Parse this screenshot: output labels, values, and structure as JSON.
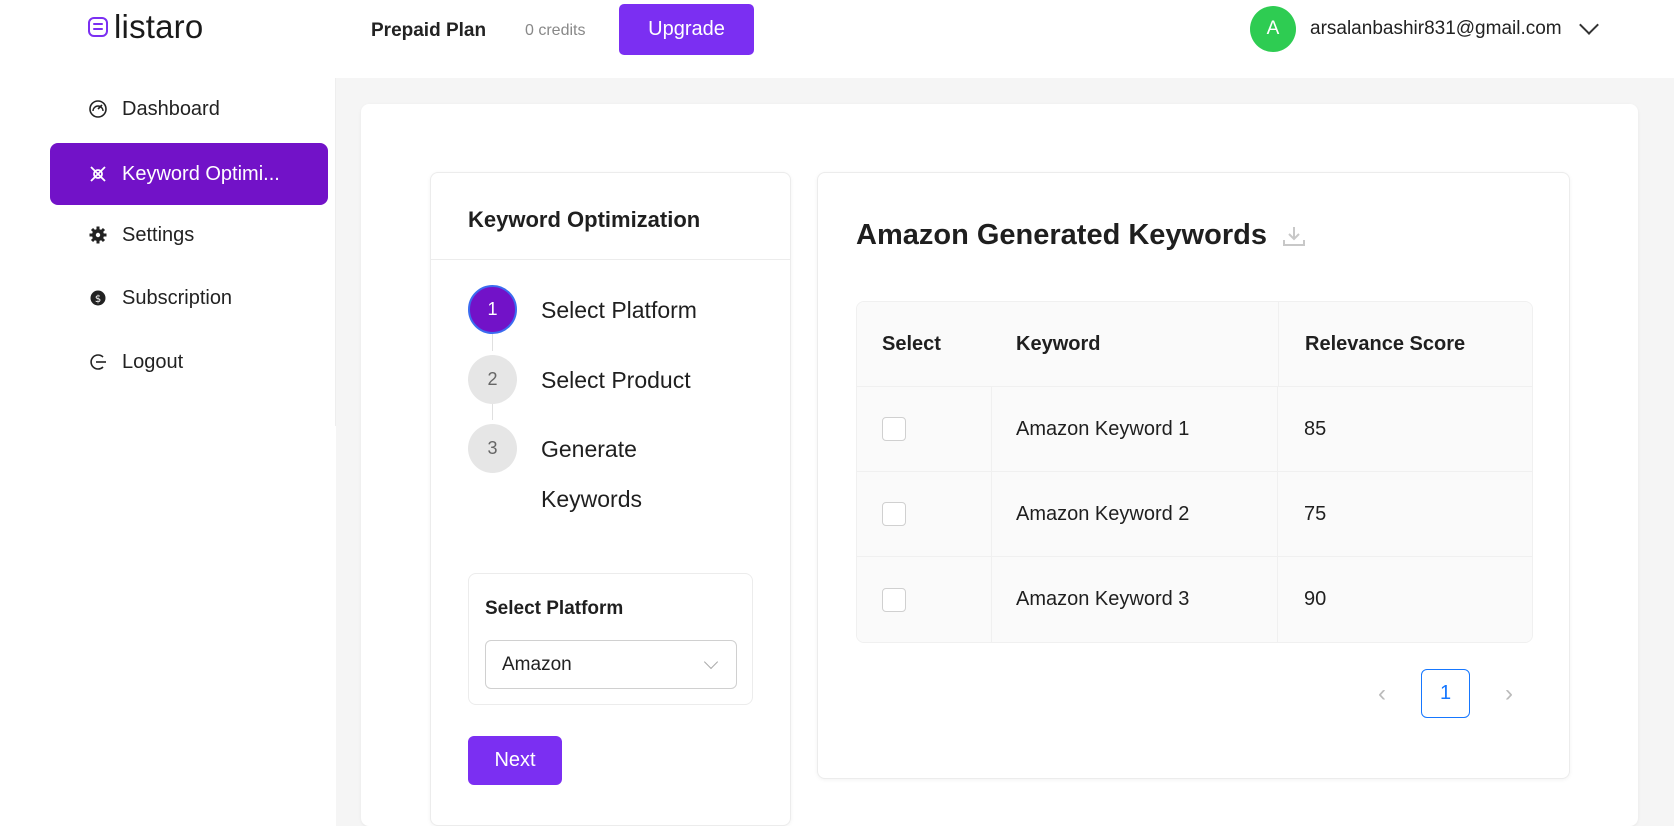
{
  "app": {
    "logo_text": "listaro",
    "plan_label": "Prepaid Plan",
    "credits_label": "0 credits",
    "upgrade_label": "Upgrade",
    "avatar_letter": "A",
    "user_email": "arsalanbashir831@gmail.com"
  },
  "sidebar": {
    "items": [
      {
        "label": "Dashboard",
        "icon": "dashboard-icon",
        "active": false
      },
      {
        "label": "Keyword Optimi...",
        "icon": "keyword-icon",
        "active": true
      },
      {
        "label": "Settings",
        "icon": "gear-icon",
        "active": false
      },
      {
        "label": "Subscription",
        "icon": "subscription-icon",
        "active": false
      },
      {
        "label": "Logout",
        "icon": "logout-icon",
        "active": false
      }
    ]
  },
  "steps": {
    "title": "Keyword Optimization",
    "items": [
      {
        "number": "1",
        "label": "Select Platform"
      },
      {
        "number": "2",
        "label": "Select Product"
      },
      {
        "number": "3",
        "label": "Generate Keywords"
      }
    ],
    "platform_label": "Select Platform",
    "platform_value": "Amazon",
    "next_label": "Next"
  },
  "results": {
    "title": "Amazon Generated Keywords",
    "columns": [
      "Select",
      "Keyword",
      "Relevance Score"
    ],
    "rows": [
      {
        "keyword": "Amazon Keyword 1",
        "score": "85"
      },
      {
        "keyword": "Amazon Keyword 2",
        "score": "75"
      },
      {
        "keyword": "Amazon Keyword 3",
        "score": "90"
      }
    ],
    "page": "1"
  },
  "colors": {
    "accent": "#7b2ff2",
    "active_nav": "#7212c8",
    "avatar": "#2ecc52",
    "pagination": "#1677ff"
  }
}
